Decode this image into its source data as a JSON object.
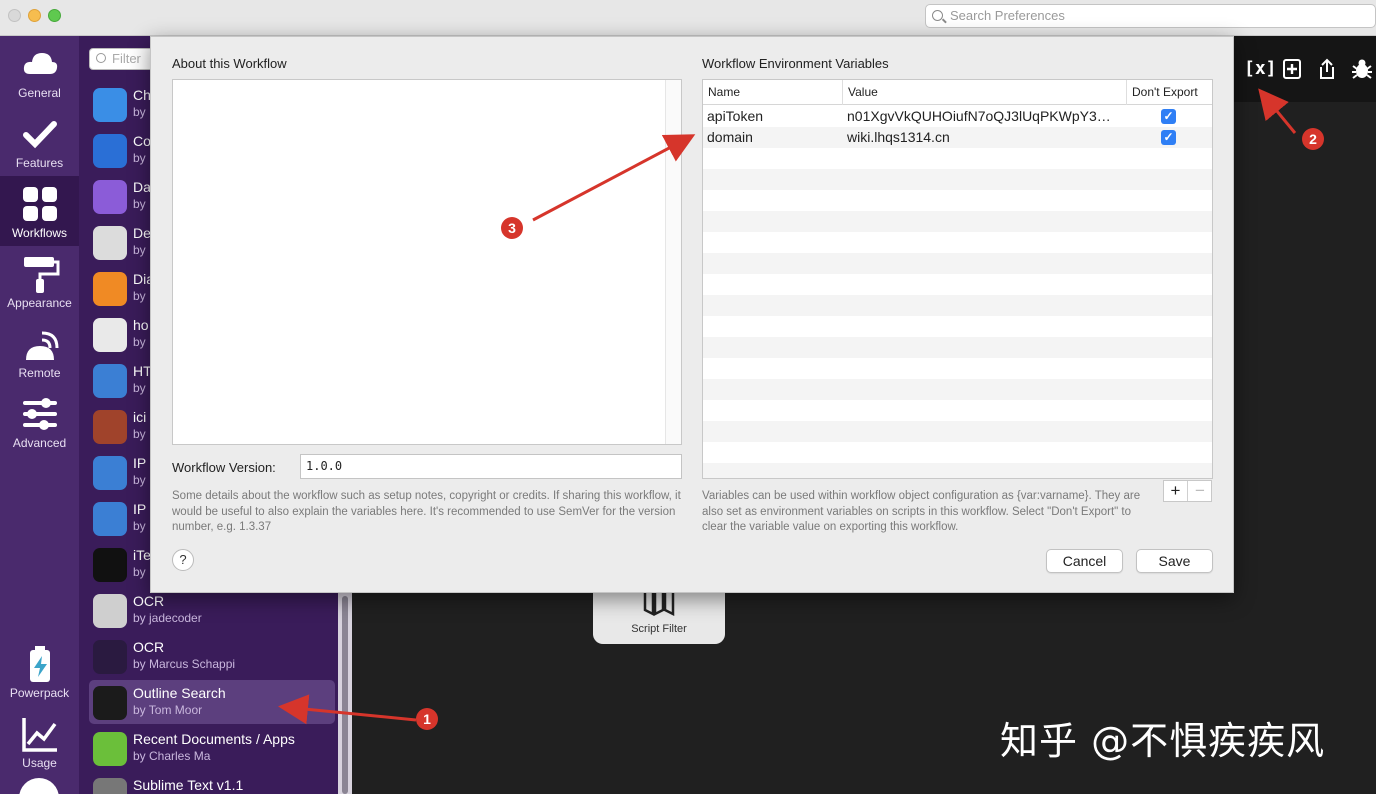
{
  "window": {
    "search_placeholder": "Search Preferences"
  },
  "leftnav": {
    "items": [
      {
        "label": "General",
        "icon": "cloud-icon"
      },
      {
        "label": "Features",
        "icon": "checkmark-icon"
      },
      {
        "label": "Workflows",
        "icon": "grid-icon"
      },
      {
        "label": "Appearance",
        "icon": "paint-roller-icon"
      },
      {
        "label": "Remote",
        "icon": "remote-icon"
      },
      {
        "label": "Advanced",
        "icon": "sliders-icon"
      },
      {
        "label": "Powerpack",
        "icon": "battery-icon"
      },
      {
        "label": "Usage",
        "icon": "chart-icon"
      }
    ],
    "active": "Workflows"
  },
  "workflows": {
    "filter_placeholder": "Filter",
    "items": [
      {
        "title": "Ch",
        "subtitle": "by",
        "color": "#3a8ee6"
      },
      {
        "title": "Co",
        "subtitle": "by",
        "color": "#2a6fd6"
      },
      {
        "title": "Da",
        "subtitle": "by",
        "color": "#8b5cd8"
      },
      {
        "title": "De",
        "subtitle": "by",
        "color": "#dcdcdc"
      },
      {
        "title": "Dia",
        "subtitle": "by",
        "color": "#f08a24"
      },
      {
        "title": "ho",
        "subtitle": "by",
        "color": "#e9e9e9"
      },
      {
        "title": "HT",
        "subtitle": "by",
        "color": "#3b7fd4"
      },
      {
        "title": "ici",
        "subtitle": "by",
        "color": "#a0432b"
      },
      {
        "title": "IP",
        "subtitle": "by",
        "color": "#3b7fd4"
      },
      {
        "title": "IP",
        "subtitle": "by",
        "color": "#3b7fd4"
      },
      {
        "title": "iTe",
        "subtitle": "by",
        "color": "#111111"
      },
      {
        "title": "OCR",
        "subtitle": "by jadecoder",
        "color": "#cfcfcf"
      },
      {
        "title": "OCR",
        "subtitle": "by Marcus Schappi",
        "color": "#2a1a40"
      },
      {
        "title": "Outline Search",
        "subtitle": "by Tom Moor",
        "color": "#1b1b1b"
      },
      {
        "title": "Recent Documents / Apps",
        "subtitle": "by Charles Ma",
        "color": "#6bbf3a"
      },
      {
        "title": "Sublime Text v1.1",
        "subtitle": "",
        "color": "#777777"
      }
    ],
    "selected_index": 13
  },
  "canvas": {
    "toolbar": [
      "variables-icon",
      "add-icon",
      "share-icon",
      "debug-icon"
    ],
    "node_label": "Script Filter",
    "watermark": "知乎 @不惧疾疾风"
  },
  "sheet": {
    "about_title": "About this Workflow",
    "about_text": "",
    "version_label": "Workflow Version:",
    "version_value": "1.0.0",
    "about_help": "Some details about the workflow such as setup notes, copyright or credits. If sharing this workflow, it would be useful to also explain the variables here. It's recommended to use SemVer for the version number, e.g. 1.3.37",
    "env_title": "Workflow Environment Variables",
    "columns": [
      "Name",
      "Value",
      "Don't Export"
    ],
    "variables": [
      {
        "name": "apiToken",
        "value": "n01XgvVkQUHOiufN7oQJ3lUqPKWpY3…",
        "dont_export": true
      },
      {
        "name": "domain",
        "value": "wiki.lhqs1314.cn",
        "dont_export": true
      }
    ],
    "vars_help": "Variables can be used within workflow object configuration as {var:varname}. They are also set as environment variables on scripts in this workflow. Select \"Don't Export\" to clear the variable value on exporting this workflow.",
    "help_button": "?",
    "cancel_label": "Cancel",
    "save_label": "Save",
    "add_label": "+",
    "remove_label": "−"
  },
  "annotations": {
    "badges": [
      "1",
      "2",
      "3"
    ],
    "color": "#d6352b"
  }
}
